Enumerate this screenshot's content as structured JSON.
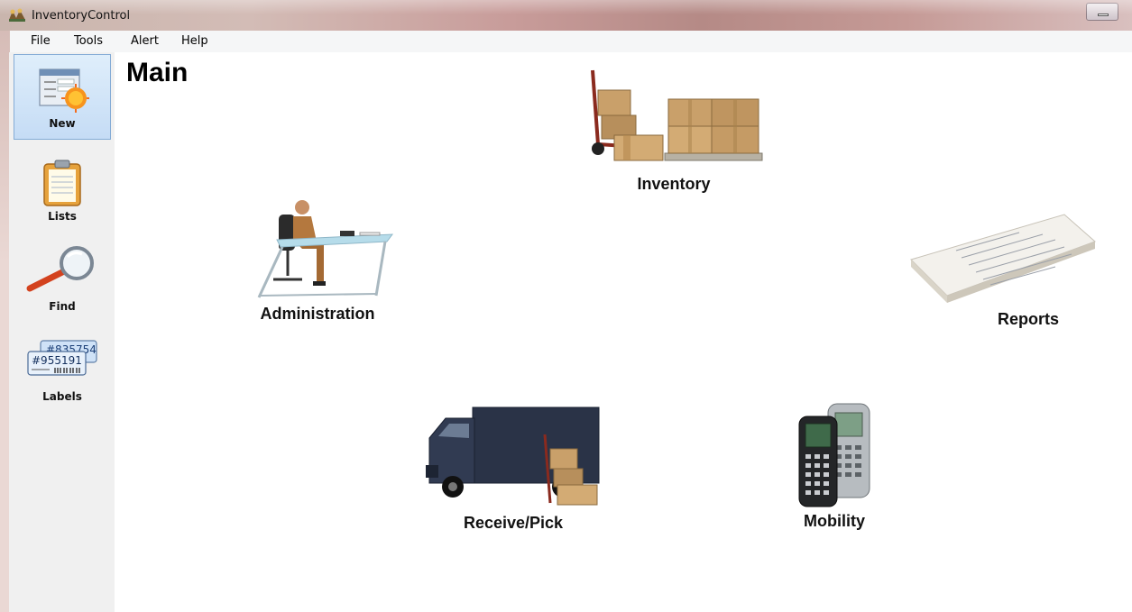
{
  "window": {
    "title": "InventoryControl"
  },
  "menu": {
    "items": [
      "File",
      "Tools",
      "Alert",
      "Help"
    ]
  },
  "sidebar": {
    "items": [
      {
        "label": "New",
        "icon": "new-form-icon",
        "active": true
      },
      {
        "label": "Lists",
        "icon": "clipboard-icon",
        "active": false
      },
      {
        "label": "Find",
        "icon": "magnifier-icon",
        "active": false
      },
      {
        "label": "Labels",
        "icon": "barcode-labels-icon",
        "active": false
      }
    ],
    "labels_icon_text": [
      "#835754",
      "#955191"
    ]
  },
  "main": {
    "title": "Main",
    "tiles": [
      {
        "label": "Inventory",
        "icon": "boxes-handtruck-icon"
      },
      {
        "label": "Administration",
        "icon": "office-desk-icon"
      },
      {
        "label": "Reports",
        "icon": "paper-stack-icon"
      },
      {
        "label": "Receive/Pick",
        "icon": "delivery-truck-icon"
      },
      {
        "label": "Mobility",
        "icon": "handheld-scanner-icon"
      }
    ]
  },
  "colors": {
    "titlebar": "#c89c9a",
    "menubar": "#f5f6f7",
    "sidebar": "#f0f0f0",
    "active_item": "#c5dcf5",
    "active_border": "#84acd6"
  }
}
